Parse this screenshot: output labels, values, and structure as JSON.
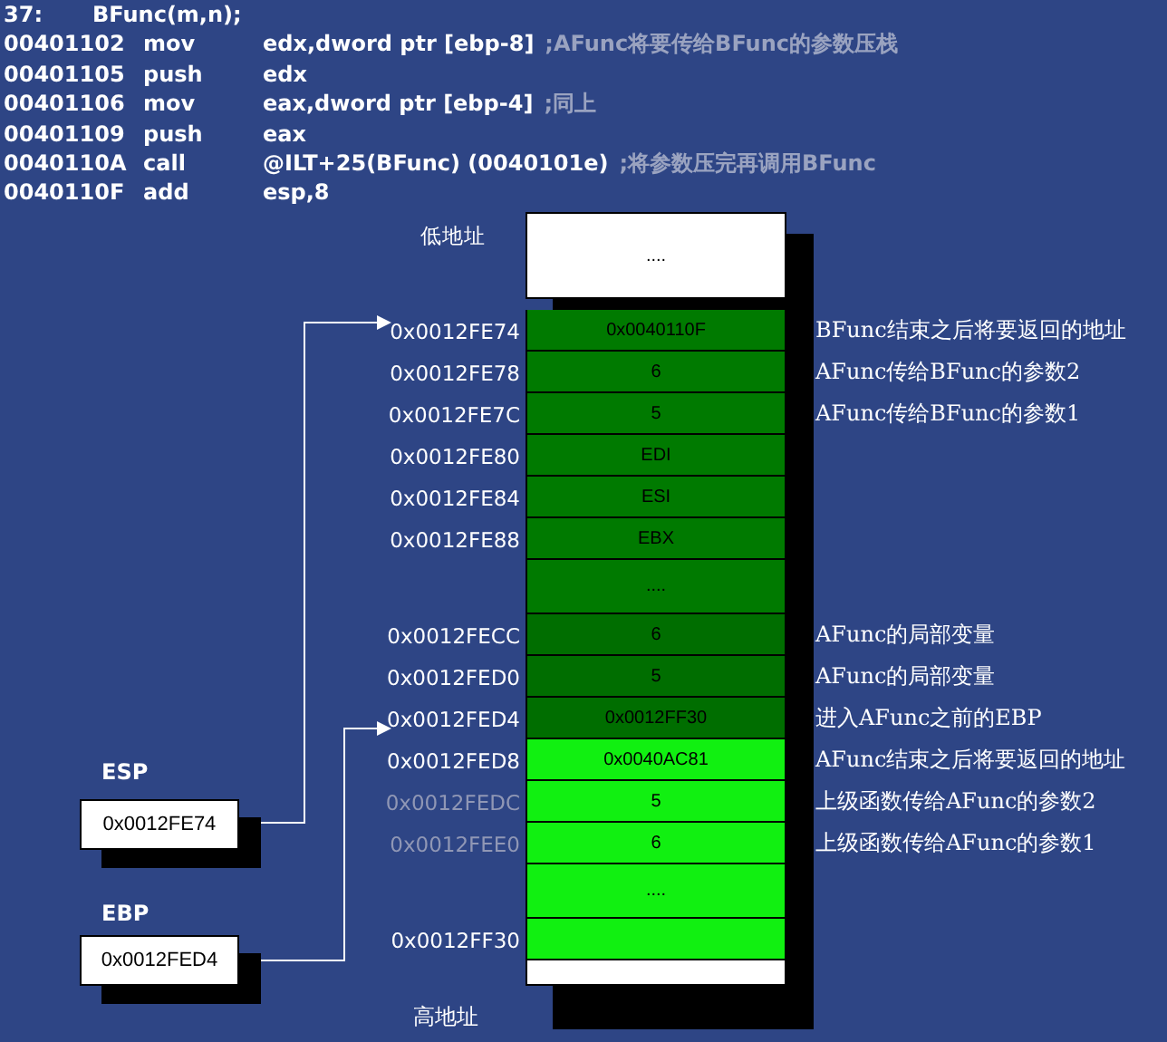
{
  "code_lines": [
    {
      "kind": "source",
      "address": "37:",
      "operands": "BFunc(m,n);"
    },
    {
      "kind": "asm",
      "address": "00401102",
      "mnemonic": "mov",
      "operands": "edx,dword ptr [ebp-8]",
      "comment": ";AFunc将要传给BFunc的参数压栈"
    },
    {
      "kind": "asm",
      "address": "00401105",
      "mnemonic": "push",
      "operands": "edx"
    },
    {
      "kind": "asm",
      "address": "00401106",
      "mnemonic": "mov",
      "operands": "eax,dword ptr [ebp-4]",
      "comment": ";同上"
    },
    {
      "kind": "asm",
      "address": "00401109",
      "mnemonic": "push",
      "operands": "eax"
    },
    {
      "kind": "asm",
      "address": "0040110A",
      "mnemonic": "call",
      "operands": "@ILT+25(BFunc) (0040101e)",
      "comment": ";将参数压完再调用BFunc"
    },
    {
      "kind": "asm",
      "address": "0040110F",
      "mnemonic": "add",
      "operands": "esp,8"
    }
  ],
  "stack": {
    "low_label": "低地址",
    "high_label": "高地址",
    "rows": [
      {
        "kind": "white",
        "address": "",
        "value": "....",
        "note": ""
      },
      {
        "kind": "dark",
        "address": "0x0012FE74",
        "value": "0x0040110F",
        "note": "BFunc结束之后将要返回的地址",
        "dimmed": false
      },
      {
        "kind": "dark",
        "address": "0x0012FE78",
        "value": "6",
        "note": "AFunc传给BFunc的参数2",
        "dimmed": false
      },
      {
        "kind": "dark",
        "address": "0x0012FE7C",
        "value": "5",
        "note": "AFunc传给BFunc的参数1",
        "dimmed": false
      },
      {
        "kind": "dark",
        "address": "0x0012FE80",
        "value": "EDI",
        "note": "",
        "dimmed": false
      },
      {
        "kind": "dark",
        "address": "0x0012FE84",
        "value": "ESI",
        "note": "",
        "dimmed": false
      },
      {
        "kind": "dark",
        "address": "0x0012FE88",
        "value": "EBX",
        "note": "",
        "dimmed": false
      },
      {
        "kind": "dark",
        "address": "",
        "value": "....",
        "note": "",
        "gap": true
      },
      {
        "kind": "mid",
        "address": "0x0012FECC",
        "value": "6",
        "note": "AFunc的局部变量",
        "dimmed": false
      },
      {
        "kind": "mid",
        "address": "0x0012FED0",
        "value": "5",
        "note": "AFunc的局部变量",
        "dimmed": false
      },
      {
        "kind": "mid",
        "address": "0x0012FED4",
        "value": "0x0012FF30",
        "note": "进入AFunc之前的EBP",
        "dimmed": false
      },
      {
        "kind": "bright",
        "address": "0x0012FED8",
        "value": "0x0040AC81",
        "note": "AFunc结束之后将要返回的地址",
        "dimmed": false
      },
      {
        "kind": "bright",
        "address": "0x0012FEDC",
        "value": "5",
        "note": "上级函数传给AFunc的参数2",
        "dimmed": true
      },
      {
        "kind": "bright",
        "address": "0x0012FEE0",
        "value": "6",
        "note": "上级函数传给AFunc的参数1",
        "dimmed": true
      },
      {
        "kind": "bright",
        "address": "",
        "value": "....",
        "note": "",
        "gap": true
      },
      {
        "kind": "bright",
        "address": "0x0012FF30",
        "value": "",
        "note": "",
        "dimmed": false
      },
      {
        "kind": "white",
        "address": "",
        "value": "",
        "note": ""
      }
    ]
  },
  "registers": [
    {
      "name": "ESP",
      "value": "0x0012FE74"
    },
    {
      "name": "EBP",
      "value": "0x0012FED4"
    }
  ]
}
